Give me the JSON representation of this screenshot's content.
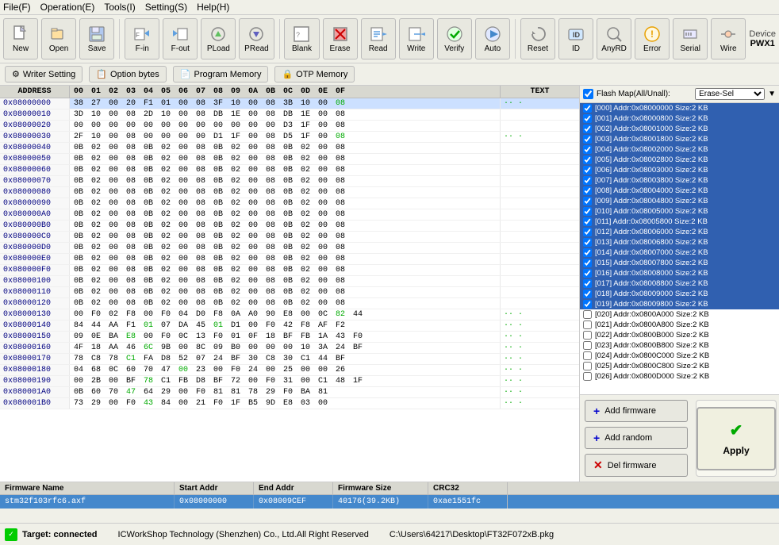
{
  "menu": {
    "items": [
      "File(F)",
      "Operation(E)",
      "Tools(I)",
      "Setting(S)",
      "Help(H)"
    ]
  },
  "toolbar": {
    "buttons": [
      {
        "id": "new",
        "label": "New",
        "icon": "📄"
      },
      {
        "id": "open",
        "label": "Open",
        "icon": "📂"
      },
      {
        "id": "save",
        "label": "Save",
        "icon": "💾"
      },
      {
        "id": "fin",
        "label": "F-in",
        "icon": "📥"
      },
      {
        "id": "fout",
        "label": "F-out",
        "icon": "📤"
      },
      {
        "id": "pload",
        "label": "PLoad",
        "icon": "🔄"
      },
      {
        "id": "pread",
        "label": "PRead",
        "icon": "🔃"
      },
      {
        "id": "blank",
        "label": "Blank",
        "icon": "⬜"
      },
      {
        "id": "erase",
        "label": "Erase",
        "icon": "🗑"
      },
      {
        "id": "read",
        "label": "Read",
        "icon": "📖"
      },
      {
        "id": "write",
        "label": "Write",
        "icon": "✏️"
      },
      {
        "id": "verify",
        "label": "Verify",
        "icon": "✔"
      },
      {
        "id": "auto",
        "label": "Auto",
        "icon": "▶"
      },
      {
        "id": "reset",
        "label": "Reset",
        "icon": "↺"
      },
      {
        "id": "id",
        "label": "ID",
        "icon": "🪪"
      },
      {
        "id": "anyrd",
        "label": "AnyRD",
        "icon": "🔍"
      },
      {
        "id": "error",
        "label": "Error",
        "icon": "⚠"
      },
      {
        "id": "serial",
        "label": "Serial",
        "icon": "📡"
      },
      {
        "id": "wire",
        "label": "Wire",
        "icon": "🔌"
      }
    ],
    "device_label": "Device",
    "device_value": "PWX1"
  },
  "toolbar2": {
    "buttons": [
      {
        "id": "writer-setting",
        "label": "Writer Setting",
        "icon": "⚙"
      },
      {
        "id": "option-bytes",
        "label": "Option bytes",
        "icon": "📋"
      },
      {
        "id": "program-memory",
        "label": "Program Memory",
        "icon": "📄"
      },
      {
        "id": "otp-memory",
        "label": "OTP Memory",
        "icon": "🔒"
      }
    ]
  },
  "hex_editor": {
    "header": {
      "address": "ADDRESS",
      "bytes": [
        "00",
        "01",
        "02",
        "03",
        "04",
        "05",
        "06",
        "07",
        "08",
        "09",
        "0A",
        "0B",
        "0C",
        "0D",
        "0E",
        "0F"
      ],
      "text": "TEXT"
    },
    "rows": [
      {
        "addr": "0x08000000",
        "bytes": [
          "38",
          "27",
          "00",
          "20",
          "F1",
          "01",
          "00",
          "08",
          "3F",
          "10",
          "00",
          "08",
          "3B",
          "10",
          "00",
          "08"
        ],
        "text": ""
      },
      {
        "addr": "0x08000010",
        "bytes": [
          "3D",
          "10",
          "00",
          "08",
          "2D",
          "10",
          "00",
          "08",
          "DB",
          "1E",
          "00",
          "08",
          "DB",
          "1E",
          "00",
          "08"
        ],
        "text": ""
      },
      {
        "addr": "0x08000020",
        "bytes": [
          "00",
          "00",
          "00",
          "00",
          "00",
          "00",
          "00",
          "00",
          "00",
          "00",
          "00",
          "00",
          "D3",
          "1F",
          "00",
          "08"
        ],
        "text": ""
      },
      {
        "addr": "0x08000030",
        "bytes": [
          "2F",
          "10",
          "00",
          "08",
          "00",
          "00",
          "00",
          "00",
          "D1",
          "1F",
          "00",
          "08",
          "D5",
          "1F",
          "00",
          "08"
        ],
        "text": ""
      },
      {
        "addr": "0x08000040",
        "bytes": [
          "0B",
          "02",
          "00",
          "08",
          "0B",
          "02",
          "00",
          "08",
          "0B",
          "02",
          "00",
          "08",
          "0B",
          "02",
          "00",
          "08"
        ],
        "text": ""
      },
      {
        "addr": "0x08000050",
        "bytes": [
          "0B",
          "02",
          "00",
          "08",
          "0B",
          "02",
          "00",
          "08",
          "0B",
          "02",
          "00",
          "08",
          "0B",
          "02",
          "00",
          "08"
        ],
        "text": ""
      },
      {
        "addr": "0x08000060",
        "bytes": [
          "0B",
          "02",
          "00",
          "08",
          "0B",
          "02",
          "00",
          "08",
          "0B",
          "02",
          "00",
          "08",
          "0B",
          "02",
          "00",
          "08"
        ],
        "text": ""
      },
      {
        "addr": "0x08000070",
        "bytes": [
          "0B",
          "02",
          "00",
          "08",
          "0B",
          "02",
          "00",
          "08",
          "0B",
          "02",
          "00",
          "08",
          "0B",
          "02",
          "00",
          "08"
        ],
        "text": ""
      },
      {
        "addr": "0x08000080",
        "bytes": [
          "0B",
          "02",
          "00",
          "08",
          "0B",
          "02",
          "00",
          "08",
          "0B",
          "02",
          "00",
          "08",
          "0B",
          "02",
          "00",
          "08"
        ],
        "text": ""
      },
      {
        "addr": "0x08000090",
        "bytes": [
          "0B",
          "02",
          "00",
          "08",
          "0B",
          "02",
          "00",
          "08",
          "0B",
          "02",
          "00",
          "08",
          "0B",
          "02",
          "00",
          "08"
        ],
        "text": ""
      },
      {
        "addr": "0x080000A0",
        "bytes": [
          "0B",
          "02",
          "00",
          "08",
          "0B",
          "02",
          "00",
          "08",
          "0B",
          "02",
          "00",
          "08",
          "0B",
          "02",
          "00",
          "08"
        ],
        "text": ""
      },
      {
        "addr": "0x080000B0",
        "bytes": [
          "0B",
          "02",
          "00",
          "08",
          "0B",
          "02",
          "00",
          "08",
          "0B",
          "02",
          "00",
          "08",
          "0B",
          "02",
          "00",
          "08"
        ],
        "text": ""
      },
      {
        "addr": "0x080000C0",
        "bytes": [
          "0B",
          "02",
          "00",
          "08",
          "0B",
          "02",
          "00",
          "08",
          "0B",
          "02",
          "00",
          "08",
          "0B",
          "02",
          "00",
          "08"
        ],
        "text": ""
      },
      {
        "addr": "0x080000D0",
        "bytes": [
          "0B",
          "02",
          "00",
          "08",
          "0B",
          "02",
          "00",
          "08",
          "0B",
          "02",
          "00",
          "08",
          "0B",
          "02",
          "00",
          "08"
        ],
        "text": ""
      },
      {
        "addr": "0x080000E0",
        "bytes": [
          "0B",
          "02",
          "00",
          "08",
          "0B",
          "02",
          "00",
          "08",
          "0B",
          "02",
          "00",
          "08",
          "0B",
          "02",
          "00",
          "08"
        ],
        "text": ""
      },
      {
        "addr": "0x080000F0",
        "bytes": [
          "0B",
          "02",
          "00",
          "08",
          "0B",
          "02",
          "00",
          "08",
          "0B",
          "02",
          "00",
          "08",
          "0B",
          "02",
          "00",
          "08"
        ],
        "text": ""
      },
      {
        "addr": "0x08000100",
        "bytes": [
          "0B",
          "02",
          "00",
          "08",
          "0B",
          "02",
          "00",
          "08",
          "0B",
          "02",
          "00",
          "08",
          "0B",
          "02",
          "00",
          "08"
        ],
        "text": ""
      },
      {
        "addr": "0x08000110",
        "bytes": [
          "0B",
          "02",
          "00",
          "08",
          "0B",
          "02",
          "00",
          "08",
          "0B",
          "02",
          "00",
          "08",
          "0B",
          "02",
          "00",
          "08"
        ],
        "text": ""
      },
      {
        "addr": "0x08000120",
        "bytes": [
          "0B",
          "02",
          "00",
          "08",
          "0B",
          "02",
          "00",
          "08",
          "0B",
          "02",
          "00",
          "08",
          "0B",
          "02",
          "00",
          "08"
        ],
        "text": ""
      },
      {
        "addr": "0x08000130",
        "bytes": [
          "00",
          "F0",
          "02",
          "F8",
          "00",
          "F0",
          "04",
          "D0",
          "F8",
          "0A",
          "A0",
          "90",
          "E8",
          "00",
          "0C",
          "82",
          "44"
        ],
        "text": ""
      },
      {
        "addr": "0x08000140",
        "bytes": [
          "84",
          "44",
          "AA",
          "F1",
          "01",
          "07",
          "DA",
          "45",
          "01",
          "D1",
          "00",
          "F0",
          "42",
          "F8",
          "AF",
          "F2"
        ],
        "text": ""
      },
      {
        "addr": "0x08000150",
        "bytes": [
          "09",
          "0E",
          "BA",
          "E8",
          "00",
          "F0",
          "0C",
          "13",
          "F0",
          "01",
          "0F",
          "18",
          "BF",
          "FB",
          "1A",
          "43",
          "F0"
        ],
        "text": ""
      },
      {
        "addr": "0x08000160",
        "bytes": [
          "4F",
          "18",
          "AA",
          "46",
          "6C",
          "9B",
          "00",
          "8C",
          "09",
          "B0",
          "00",
          "00",
          "00",
          "10",
          "3A",
          "24",
          "BF"
        ],
        "text": ""
      },
      {
        "addr": "0x08000170",
        "bytes": [
          "78",
          "C8",
          "78",
          "C1",
          "FA",
          "D8",
          "52",
          "07",
          "24",
          "BF",
          "30",
          "C8",
          "30",
          "C1",
          "44",
          "BF"
        ],
        "text": ""
      },
      {
        "addr": "0x08000180",
        "bytes": [
          "04",
          "68",
          "0C",
          "60",
          "70",
          "47",
          "00",
          "23",
          "00",
          "F0",
          "24",
          "00",
          "25",
          "00",
          "00",
          "26"
        ],
        "text": ""
      },
      {
        "addr": "0x08000190",
        "bytes": [
          "00",
          "2B",
          "00",
          "BF",
          "78",
          "C1",
          "FB",
          "D8",
          "BF",
          "72",
          "00",
          "F0",
          "31",
          "00",
          "C1",
          "48",
          "1F"
        ],
        "text": ""
      },
      {
        "addr": "0x080001A0",
        "bytes": [
          "0B",
          "60",
          "70",
          "47",
          "64",
          "29",
          "00",
          "F0",
          "81",
          "81",
          "78",
          "29",
          "F0",
          "BA",
          "81"
        ],
        "text": ""
      },
      {
        "addr": "0x080001B0",
        "bytes": [
          "73",
          "29",
          "00",
          "F0",
          "43",
          "84",
          "00",
          "21",
          "F0",
          "1F",
          "B5",
          "9D",
          "E8",
          "03",
          "00"
        ],
        "text": ""
      }
    ]
  },
  "firmware_table": {
    "headers": [
      "Firmware Name",
      "Start Addr",
      "End Addr",
      "Firmware Size",
      "CRC32"
    ],
    "rows": [
      {
        "name": "stm32f103rfc6.axf",
        "start_addr": "0x08000000",
        "end_addr": "0x08009CEF",
        "size": "40176(39.2KB)",
        "crc32": "0xae1551fc"
      }
    ]
  },
  "flash_map": {
    "header_label": "Flash Map(All/Unall):",
    "dropdown_options": [
      "Erase-Sel"
    ],
    "dropdown_value": "Erase-Sel",
    "header_checked": true,
    "items": [
      {
        "id": "000",
        "label": "[000] Addr:0x08000000 Size:2 KB",
        "checked": true
      },
      {
        "id": "001",
        "label": "[001] Addr:0x08000800 Size:2 KB",
        "checked": true
      },
      {
        "id": "002",
        "label": "[002] Addr:0x08001000 Size:2 KB",
        "checked": true
      },
      {
        "id": "003",
        "label": "[003] Addr:0x08001800 Size:2 KB",
        "checked": true
      },
      {
        "id": "004",
        "label": "[004] Addr:0x08002000 Size:2 KB",
        "checked": true
      },
      {
        "id": "005",
        "label": "[005] Addr:0x08002800 Size:2 KB",
        "checked": true
      },
      {
        "id": "006",
        "label": "[006] Addr:0x08003000 Size:2 KB",
        "checked": true
      },
      {
        "id": "007",
        "label": "[007] Addr:0x08003800 Size:2 KB",
        "checked": true
      },
      {
        "id": "008",
        "label": "[008] Addr:0x08004000 Size:2 KB",
        "checked": true
      },
      {
        "id": "009",
        "label": "[009] Addr:0x08004800 Size:2 KB",
        "checked": true
      },
      {
        "id": "010",
        "label": "[010] Addr:0x08005000 Size:2 KB",
        "checked": true
      },
      {
        "id": "011",
        "label": "[011] Addr:0x08005800 Size:2 KB",
        "checked": true
      },
      {
        "id": "012",
        "label": "[012] Addr:0x08006000 Size:2 KB",
        "checked": true
      },
      {
        "id": "013",
        "label": "[013] Addr:0x08006800 Size:2 KB",
        "checked": true
      },
      {
        "id": "014",
        "label": "[014] Addr:0x08007000 Size:2 KB",
        "checked": true
      },
      {
        "id": "015",
        "label": "[015] Addr:0x08007800 Size:2 KB",
        "checked": true
      },
      {
        "id": "016",
        "label": "[016] Addr:0x08008000 Size:2 KB",
        "checked": true
      },
      {
        "id": "017",
        "label": "[017] Addr:0x08008800 Size:2 KB",
        "checked": true
      },
      {
        "id": "018",
        "label": "[018] Addr:0x08009000 Size:2 KB",
        "checked": true
      },
      {
        "id": "019",
        "label": "[019] Addr:0x08009800 Size:2 KB",
        "checked": true
      },
      {
        "id": "020",
        "label": "[020] Addr:0x0800A000 Size:2 KB",
        "checked": false
      },
      {
        "id": "021",
        "label": "[021] Addr:0x0800A800 Size:2 KB",
        "checked": false
      },
      {
        "id": "022",
        "label": "[022] Addr:0x0800B000 Size:2 KB",
        "checked": false
      },
      {
        "id": "023",
        "label": "[023] Addr:0x0800B800 Size:2 KB",
        "checked": false
      },
      {
        "id": "024",
        "label": "[024] Addr:0x0800C000 Size:2 KB",
        "checked": false
      },
      {
        "id": "025",
        "label": "[025] Addr:0x0800C800 Size:2 KB",
        "checked": false
      },
      {
        "id": "026",
        "label": "[026] Addr:0x0800D000 Size:2 KB",
        "checked": false
      }
    ]
  },
  "right_buttons": {
    "add_firmware": "Add firmware",
    "add_random": "Add random",
    "del_firmware": "Del firmware",
    "apply": "Apply"
  },
  "statusbar": {
    "connected_label": "Target: connected",
    "copyright": "ICWorkShop Technology (Shenzhen) Co., Ltd.All Right Reserved",
    "file_path": "C:\\Users\\64217\\Desktop\\FT32F072xB.pkg"
  }
}
